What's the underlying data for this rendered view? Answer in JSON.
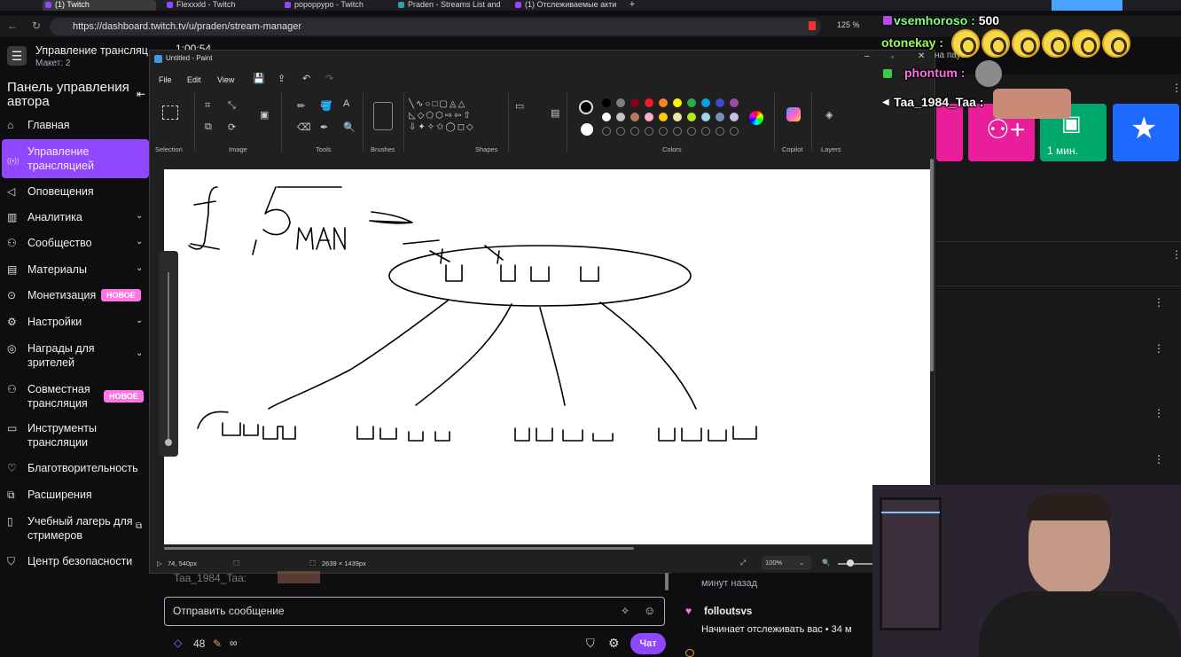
{
  "browser": {
    "tabs": [
      {
        "label": "(1) Twitch",
        "active": true
      },
      {
        "label": "Flexxxld - Twitch",
        "active": false
      },
      {
        "label": "popoppypo - Twitch",
        "active": false
      },
      {
        "label": "Praden - Streams List and",
        "active": false
      },
      {
        "label": "(1) Отслеживаемые акти",
        "active": false
      }
    ],
    "url": "https://dashboard.twitch.tv/u/praden/stream-manager",
    "zoom": "125 %"
  },
  "dashboard": {
    "page_title": "Управление трансляц...",
    "layout": "Макет: 2",
    "panel_title": "Панель управления автора",
    "timer": "1:00:54",
    "new_badge": "НОВОЕ",
    "nav": [
      {
        "label": "Главная",
        "icon": "home-icon",
        "chevron": false
      },
      {
        "label": "Управление трансляцией",
        "icon": "broadcast-icon",
        "chevron": false,
        "active": true
      },
      {
        "label": "Оповещения",
        "icon": "megaphone-icon",
        "chevron": false
      },
      {
        "label": "Аналитика",
        "icon": "chart-icon",
        "chevron": true
      },
      {
        "label": "Сообщество",
        "icon": "community-icon",
        "chevron": true
      },
      {
        "label": "Материалы",
        "icon": "content-icon",
        "chevron": true
      },
      {
        "label": "Монетизация",
        "icon": "money-icon",
        "chevron": false,
        "badge": true
      },
      {
        "label": "Настройки",
        "icon": "gear-icon",
        "chevron": true
      },
      {
        "label": "Награды для зрителей",
        "icon": "reward-icon",
        "chevron": true
      },
      {
        "label": "Совместная трансляция",
        "icon": "add-user-icon",
        "chevron": false,
        "badge": true
      },
      {
        "label": "Инструменты трансляции",
        "icon": "camera-icon",
        "chevron": false
      },
      {
        "label": "Благотворительность",
        "icon": "charity-icon",
        "chevron": false
      },
      {
        "label": "Расширения",
        "icon": "puzzle-icon",
        "chevron": false
      },
      {
        "label": "Учебный лагерь для стримеров",
        "icon": "book-icon",
        "chevron": false,
        "external": true
      },
      {
        "label": "Центр безопасности",
        "icon": "shield-icon",
        "chevron": false
      }
    ],
    "tile_label": "1 мин.",
    "chat_placeholder": "Отправить сообщение",
    "points": "48",
    "infinity": "∞",
    "chat_button": "Чат",
    "chat_bg_line": "Taa_1984_Taa:",
    "activity": [
      {
        "text": "минут назад"
      },
      {
        "user": "folloutsvs",
        "text": "Начинает отслеживать вас • 34 м"
      }
    ]
  },
  "paint": {
    "title": "Untitled - Paint",
    "menu": [
      "File",
      "Edit",
      "View"
    ],
    "groups": [
      "Selection",
      "Image",
      "Tools",
      "Brushes",
      "Shapes",
      "Colors",
      "Copilot",
      "Layers"
    ],
    "status_pos": "74, 540px",
    "status_size": "2639 × 1439px",
    "zoom": "100%",
    "palette": [
      "#000000",
      "#7f7f7f",
      "#880015",
      "#ed1c24",
      "#ff7f27",
      "#fff200",
      "#22b14c",
      "#00a2e8",
      "#3f48cc",
      "#a349a4",
      "#ffffff",
      "#c3c3c3",
      "#b97a57",
      "#ffaec9",
      "#ffc90e",
      "#efe4b0",
      "#b5e61d",
      "#99d9ea",
      "#7092be",
      "#c8bfe7"
    ]
  },
  "chat_overlay": [
    {
      "user": "vsemhoroso :",
      "text": "500",
      "color": "#7fff7f"
    },
    {
      "user": "otonekay :",
      "text": "",
      "color": "#9bff4a"
    },
    {
      "user": "phontum :",
      "text": "",
      "color": "#ff6ee0"
    },
    {
      "user": "Taa_1984_Taa :",
      "text": "",
      "color": "#ffffff"
    }
  ],
  "overlay_bg_text": "на паузе",
  "colors": {
    "twitch_purple": "#9147ff",
    "pink_tile": "#e91e9b",
    "green_tile": "#00a86b",
    "blue_tile": "#1e69ff"
  }
}
